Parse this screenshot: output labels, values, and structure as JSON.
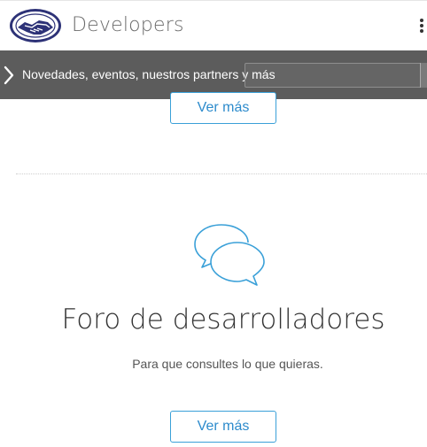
{
  "header": {
    "brand_name": "Developers",
    "logo_icon": "handshake-logo-icon",
    "menu_icon": "kebab-menu-icon"
  },
  "subnav": {
    "chevron_icon": "chevron-right-icon",
    "text": "Novedades, eventos, nuestros partners y más",
    "search_placeholder": "",
    "search_value": ""
  },
  "section_prev": {
    "button_label": "Ver más"
  },
  "forum": {
    "icon": "chat-bubbles-icon",
    "title": "Foro de desarrolladores",
    "subtitle": "Para que consultes lo que quieras.",
    "button_label": "Ver más"
  },
  "colors": {
    "accent": "#3aa0d8",
    "subnav_bg": "#5c5c5c",
    "logo_blue": "#2d3277"
  }
}
